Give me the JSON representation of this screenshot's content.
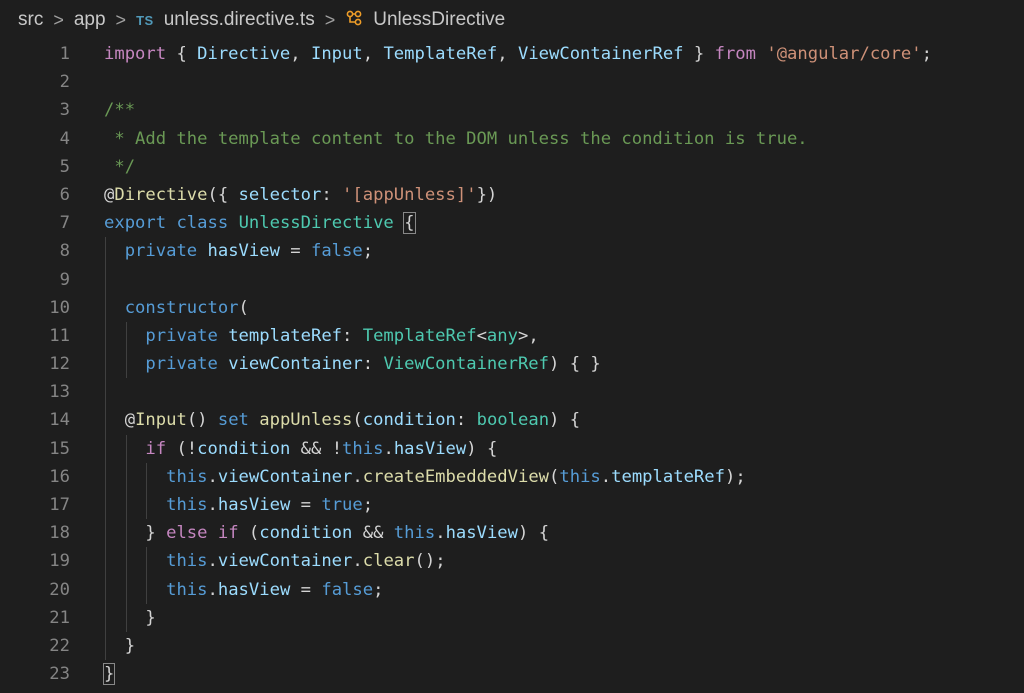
{
  "breadcrumb": {
    "segments": [
      "src",
      "app"
    ],
    "separator": ">",
    "file_badge": "TS",
    "file_name": "unless.directive.ts",
    "symbol_icon": "class-symbol-icon",
    "symbol_name": "UnlessDirective"
  },
  "editor": {
    "language": "typescript",
    "lines": [
      {
        "n": "1",
        "indent": 0,
        "tokens": [
          [
            "ctl",
            "import"
          ],
          [
            "punc",
            " { "
          ],
          [
            "var",
            "Directive"
          ],
          [
            "punc",
            ", "
          ],
          [
            "var",
            "Input"
          ],
          [
            "punc",
            ", "
          ],
          [
            "var",
            "TemplateRef"
          ],
          [
            "punc",
            ", "
          ],
          [
            "var",
            "ViewContainerRef"
          ],
          [
            "punc",
            " } "
          ],
          [
            "ctl",
            "from"
          ],
          [
            "punc",
            " "
          ],
          [
            "str",
            "'@angular/core'"
          ],
          [
            "punc",
            ";"
          ]
        ]
      },
      {
        "n": "2",
        "indent": 0,
        "tokens": []
      },
      {
        "n": "3",
        "indent": 0,
        "tokens": [
          [
            "cmt",
            "/**"
          ]
        ]
      },
      {
        "n": "4",
        "indent": 0,
        "tokens": [
          [
            "cmt",
            " * Add the template content to the DOM unless the condition is true."
          ]
        ]
      },
      {
        "n": "5",
        "indent": 0,
        "tokens": [
          [
            "cmt",
            " */"
          ]
        ]
      },
      {
        "n": "6",
        "indent": 0,
        "tokens": [
          [
            "punc",
            "@"
          ],
          [
            "fn",
            "Directive"
          ],
          [
            "punc",
            "({ "
          ],
          [
            "var",
            "selector"
          ],
          [
            "punc",
            ": "
          ],
          [
            "str",
            "'[appUnless]'"
          ],
          [
            "punc",
            "})"
          ]
        ]
      },
      {
        "n": "7",
        "indent": 0,
        "tokens": [
          [
            "kw",
            "export"
          ],
          [
            "punc",
            " "
          ],
          [
            "kw",
            "class"
          ],
          [
            "punc",
            " "
          ],
          [
            "cls",
            "UnlessDirective"
          ],
          [
            "punc",
            " "
          ],
          [
            "bm",
            "{"
          ]
        ]
      },
      {
        "n": "8",
        "indent": 1,
        "tokens": [
          [
            "kw",
            "private"
          ],
          [
            "punc",
            " "
          ],
          [
            "var",
            "hasView"
          ],
          [
            "punc",
            " = "
          ],
          [
            "kw",
            "false"
          ],
          [
            "punc",
            ";"
          ]
        ]
      },
      {
        "n": "9",
        "indent": 1,
        "tokens": []
      },
      {
        "n": "10",
        "indent": 1,
        "tokens": [
          [
            "kw",
            "constructor"
          ],
          [
            "punc",
            "("
          ]
        ]
      },
      {
        "n": "11",
        "indent": 2,
        "tokens": [
          [
            "kw",
            "private"
          ],
          [
            "punc",
            " "
          ],
          [
            "var",
            "templateRef"
          ],
          [
            "punc",
            ": "
          ],
          [
            "cls",
            "TemplateRef"
          ],
          [
            "punc",
            "<"
          ],
          [
            "cls",
            "any"
          ],
          [
            "punc",
            ">,"
          ]
        ]
      },
      {
        "n": "12",
        "indent": 2,
        "tokens": [
          [
            "kw",
            "private"
          ],
          [
            "punc",
            " "
          ],
          [
            "var",
            "viewContainer"
          ],
          [
            "punc",
            ": "
          ],
          [
            "cls",
            "ViewContainerRef"
          ],
          [
            "punc",
            ") { }"
          ]
        ]
      },
      {
        "n": "13",
        "indent": 1,
        "tokens": []
      },
      {
        "n": "14",
        "indent": 1,
        "tokens": [
          [
            "punc",
            "@"
          ],
          [
            "fn",
            "Input"
          ],
          [
            "punc",
            "() "
          ],
          [
            "kw",
            "set"
          ],
          [
            "punc",
            " "
          ],
          [
            "fn",
            "appUnless"
          ],
          [
            "punc",
            "("
          ],
          [
            "var",
            "condition"
          ],
          [
            "punc",
            ": "
          ],
          [
            "cls",
            "boolean"
          ],
          [
            "punc",
            ") {"
          ]
        ]
      },
      {
        "n": "15",
        "indent": 2,
        "tokens": [
          [
            "ctl",
            "if"
          ],
          [
            "punc",
            " (!"
          ],
          [
            "var",
            "condition"
          ],
          [
            "punc",
            " && !"
          ],
          [
            "kw",
            "this"
          ],
          [
            "punc",
            "."
          ],
          [
            "var",
            "hasView"
          ],
          [
            "punc",
            ") {"
          ]
        ]
      },
      {
        "n": "16",
        "indent": 3,
        "tokens": [
          [
            "kw",
            "this"
          ],
          [
            "punc",
            "."
          ],
          [
            "var",
            "viewContainer"
          ],
          [
            "punc",
            "."
          ],
          [
            "fn",
            "createEmbeddedView"
          ],
          [
            "punc",
            "("
          ],
          [
            "kw",
            "this"
          ],
          [
            "punc",
            "."
          ],
          [
            "var",
            "templateRef"
          ],
          [
            "punc",
            ");"
          ]
        ]
      },
      {
        "n": "17",
        "indent": 3,
        "tokens": [
          [
            "kw",
            "this"
          ],
          [
            "punc",
            "."
          ],
          [
            "var",
            "hasView"
          ],
          [
            "punc",
            " = "
          ],
          [
            "kw",
            "true"
          ],
          [
            "punc",
            ";"
          ]
        ]
      },
      {
        "n": "18",
        "indent": 2,
        "tokens": [
          [
            "punc",
            "} "
          ],
          [
            "ctl",
            "else if"
          ],
          [
            "punc",
            " ("
          ],
          [
            "var",
            "condition"
          ],
          [
            "punc",
            " && "
          ],
          [
            "kw",
            "this"
          ],
          [
            "punc",
            "."
          ],
          [
            "var",
            "hasView"
          ],
          [
            "punc",
            ") {"
          ]
        ]
      },
      {
        "n": "19",
        "indent": 3,
        "tokens": [
          [
            "kw",
            "this"
          ],
          [
            "punc",
            "."
          ],
          [
            "var",
            "viewContainer"
          ],
          [
            "punc",
            "."
          ],
          [
            "fn",
            "clear"
          ],
          [
            "punc",
            "();"
          ]
        ]
      },
      {
        "n": "20",
        "indent": 3,
        "tokens": [
          [
            "kw",
            "this"
          ],
          [
            "punc",
            "."
          ],
          [
            "var",
            "hasView"
          ],
          [
            "punc",
            " = "
          ],
          [
            "kw",
            "false"
          ],
          [
            "punc",
            ";"
          ]
        ]
      },
      {
        "n": "21",
        "indent": 2,
        "tokens": [
          [
            "punc",
            "}"
          ]
        ]
      },
      {
        "n": "22",
        "indent": 1,
        "tokens": [
          [
            "punc",
            "}"
          ]
        ]
      },
      {
        "n": "23",
        "indent": 0,
        "tokens": [
          [
            "bm",
            "}"
          ]
        ]
      }
    ]
  },
  "colors": {
    "background": "#1e1e1e",
    "line_number": "#858585",
    "keyword": "#569cd6",
    "control": "#c586c0",
    "type": "#4ec9b0",
    "function": "#dcdcaa",
    "variable": "#9cdcfe",
    "string": "#ce9178",
    "comment": "#6a9955"
  }
}
